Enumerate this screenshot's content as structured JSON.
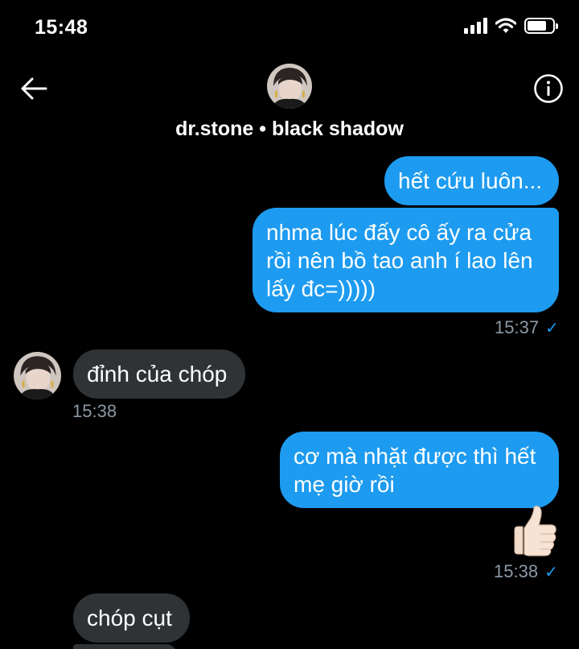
{
  "status_bar": {
    "time": "15:48"
  },
  "header": {
    "title": "dr.stone • black shadow"
  },
  "messages": {
    "out1": "hết cứu luôn...",
    "out2_line1": "nhma lúc đấy cô ấy ra cửa",
    "out2_line2": "rồi nên bồ tao anh í lao lên",
    "out2_line3": "lấy đc=)))))",
    "ts1": "15:37",
    "in1": "đỉnh của chóp",
    "ts2": "15:38",
    "out3_line1": "cơ mà nhặt được thì hết",
    "out3_line2": "mẹ giờ rồi",
    "ts3": "15:38",
    "in2": "chóp cụt"
  },
  "icons": {
    "back": "arrow-left-icon",
    "info": "info-icon",
    "read_receipt": "check-icon",
    "reaction": "thumbs-up-emoji"
  },
  "colors": {
    "background": "#000000",
    "outgoing_bubble": "#1d9bf0",
    "incoming_bubble": "#2f3336",
    "timestamp": "#8b98a5"
  }
}
